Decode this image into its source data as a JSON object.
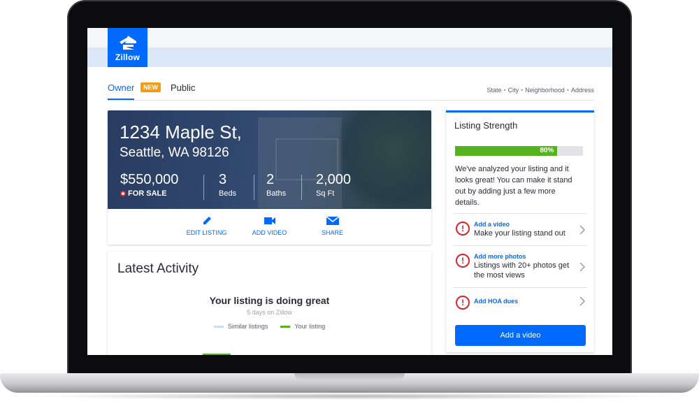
{
  "brand": {
    "logo_text": "Zillow",
    "accent_color": "#006aff"
  },
  "tabs": {
    "owner": "Owner",
    "owner_badge": "NEW",
    "public": "Public"
  },
  "breadcrumb": [
    "State",
    "City",
    "Neighborhood",
    "Address"
  ],
  "property": {
    "street": "1234 Maple St,",
    "city_line": "Seattle, WA 98126",
    "price": "$550,000",
    "status": "FOR SALE",
    "beds": {
      "value": "3",
      "label": "Beds"
    },
    "baths": {
      "value": "2",
      "label": "Baths"
    },
    "sqft": {
      "value": "2,000",
      "label": "Sq Ft"
    }
  },
  "actions": [
    {
      "label": "EDIT LISTING",
      "icon": "pencil-icon"
    },
    {
      "label": "ADD VIDEO",
      "icon": "video-camera-icon"
    },
    {
      "label": "SHARE",
      "icon": "envelope-icon"
    }
  ],
  "activity": {
    "title": "Latest Activity",
    "headline": "Your listing is doing great",
    "subtext": "5 days on Zillow",
    "legend": [
      {
        "label": "Similar listings",
        "color": "#c9def5"
      },
      {
        "label": "Your listing",
        "color": "#55b31f"
      }
    ]
  },
  "strength": {
    "title": "Listing Strength",
    "percent": 80,
    "percent_label": "80%",
    "description": "We've analyzed your listing and it looks great! You can make it stand out by adding just a few more details.",
    "tips": [
      {
        "title": "Add a video",
        "text": "Make your listing stand out",
        "icon": "alert-circle-icon"
      },
      {
        "title": "Add more photos",
        "text": "Listings with 20+ photos get the most views",
        "icon": "alert-circle-icon"
      },
      {
        "title": "Add HOA dues",
        "text": "",
        "icon": "alert-circle-icon"
      }
    ],
    "cta_label": "Add a video"
  }
}
